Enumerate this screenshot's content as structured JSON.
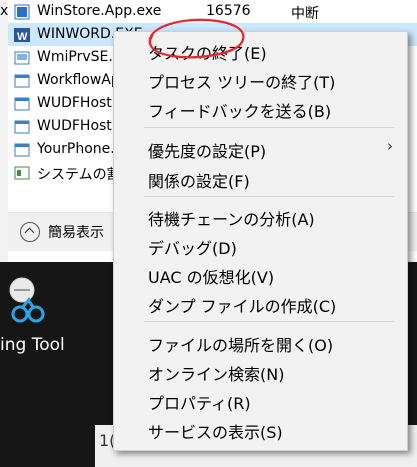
{
  "taskmgr": {
    "cut_char": "x",
    "rows": [
      {
        "name": "WinStore.App.exe",
        "pid": "16576",
        "status": "中断",
        "icon": "store-app-icon"
      },
      {
        "name": "WINWORD.EXE",
        "pid": "",
        "status": "",
        "icon": "word-icon"
      },
      {
        "name": "WmiPrvSE.e",
        "pid": "",
        "status": "",
        "icon": "wmi-icon"
      },
      {
        "name": "WorkflowAp",
        "pid": "",
        "status": "",
        "icon": "app-icon"
      },
      {
        "name": "WUDFHost.",
        "pid": "",
        "status": "",
        "icon": "app-icon"
      },
      {
        "name": "WUDFHost.",
        "pid": "",
        "status": "",
        "icon": "app-icon"
      },
      {
        "name": "YourPhone.",
        "pid": "",
        "status": "",
        "icon": "app-icon"
      },
      {
        "name": "システムの割",
        "pid": "",
        "status": "",
        "icon": "system-icon"
      }
    ],
    "less_details": "簡易表示"
  },
  "desktop": {
    "snip_label": "ing Tool"
  },
  "bottom_strip": {
    "num": "1("
  },
  "menu": {
    "items": [
      {
        "label": "タスクの終了(E)"
      },
      {
        "label": "プロセス ツリーの終了(T)"
      },
      {
        "label": "フィードバックを送る(B)"
      },
      {
        "label": "優先度の設定(P)",
        "submenu": true
      },
      {
        "label": "関係の設定(F)"
      },
      {
        "label": "待機チェーンの分析(A)"
      },
      {
        "label": "デバッグ(D)"
      },
      {
        "label": "UAC の仮想化(V)"
      },
      {
        "label": "ダンプ ファイルの作成(C)"
      },
      {
        "label": "ファイルの場所を開く(O)"
      },
      {
        "label": "オンライン検索(N)"
      },
      {
        "label": "プロパティ(R)"
      },
      {
        "label": "サービスの表示(S)"
      }
    ],
    "submenu_arrow": "›"
  },
  "colors": {
    "selected_row": "#cce8ff",
    "menu_bg": "#f2f2f2",
    "annotation": "#e8262b"
  }
}
